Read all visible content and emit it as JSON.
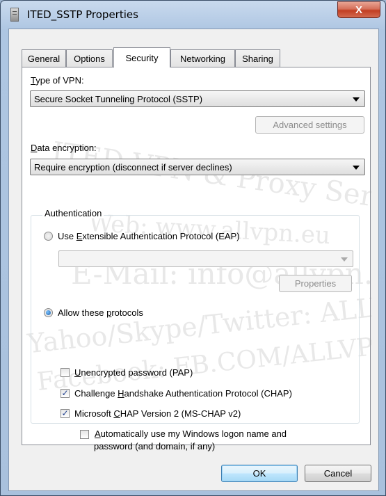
{
  "window": {
    "title": "ITED_SSTP Properties",
    "close_glyph": "X"
  },
  "tabs": [
    {
      "label": "General"
    },
    {
      "label": "Options"
    },
    {
      "label": "Security"
    },
    {
      "label": "Networking"
    },
    {
      "label": "Sharing"
    }
  ],
  "active_tab": "Security",
  "security": {
    "vpn_type_label": "Type of VPN:",
    "vpn_type_mnemonic": "T",
    "vpn_type_rest": "ype of VPN:",
    "vpn_type_value": "Secure Socket Tunneling Protocol (SSTP)",
    "advanced_button": "Advanced settings",
    "data_encryption_mnemonic": "D",
    "data_encryption_rest": "ata encryption:",
    "data_encryption_value": "Require encryption (disconnect if server declines)",
    "authentication_label": "Authentication",
    "eap_radio_pre": "Use ",
    "eap_radio_mnemonic": "E",
    "eap_radio_post": "xtensible Authentication Protocol (EAP)",
    "eap_value": "",
    "properties_button": "Properties",
    "allow_radio_pre": "Allow these ",
    "allow_radio_mnemonic": "p",
    "allow_radio_post": "rotocols",
    "pap_mnemonic": "U",
    "pap_rest": "nencrypted password (PAP)",
    "chap_pre": "Challenge ",
    "chap_mnemonic": "H",
    "chap_post": "andshake Authentication Protocol (CHAP)",
    "mschap_pre": "Microsoft ",
    "mschap_mnemonic": "C",
    "mschap_post": "HAP Version 2 (MS-CHAP v2)",
    "autologon_mnemonic": "A",
    "autologon_line1_rest": "utomatically use my Windows logon name and",
    "autologon_line2": "password (and domain, if any)",
    "eap_checked": false,
    "allow_checked": true,
    "pap_checked": false,
    "chap_checked": true,
    "mschap_checked": true,
    "autologon_checked": false
  },
  "footer": {
    "ok": "OK",
    "cancel": "Cancel"
  },
  "watermark": {
    "line1": "ITED VPN & Proxy Services",
    "line2": "Web: www.allvpn.eu",
    "line3": "E-Mail: info@allvpn.eu",
    "line4": "Yahoo/Skype/Twitter: ALLVPN",
    "line5": "Facebook: FB.COM/ALLVPN"
  },
  "colors": {
    "accent": "#1f5fa8",
    "close_red": "#c13e22",
    "frame": "#a9c1dd"
  }
}
